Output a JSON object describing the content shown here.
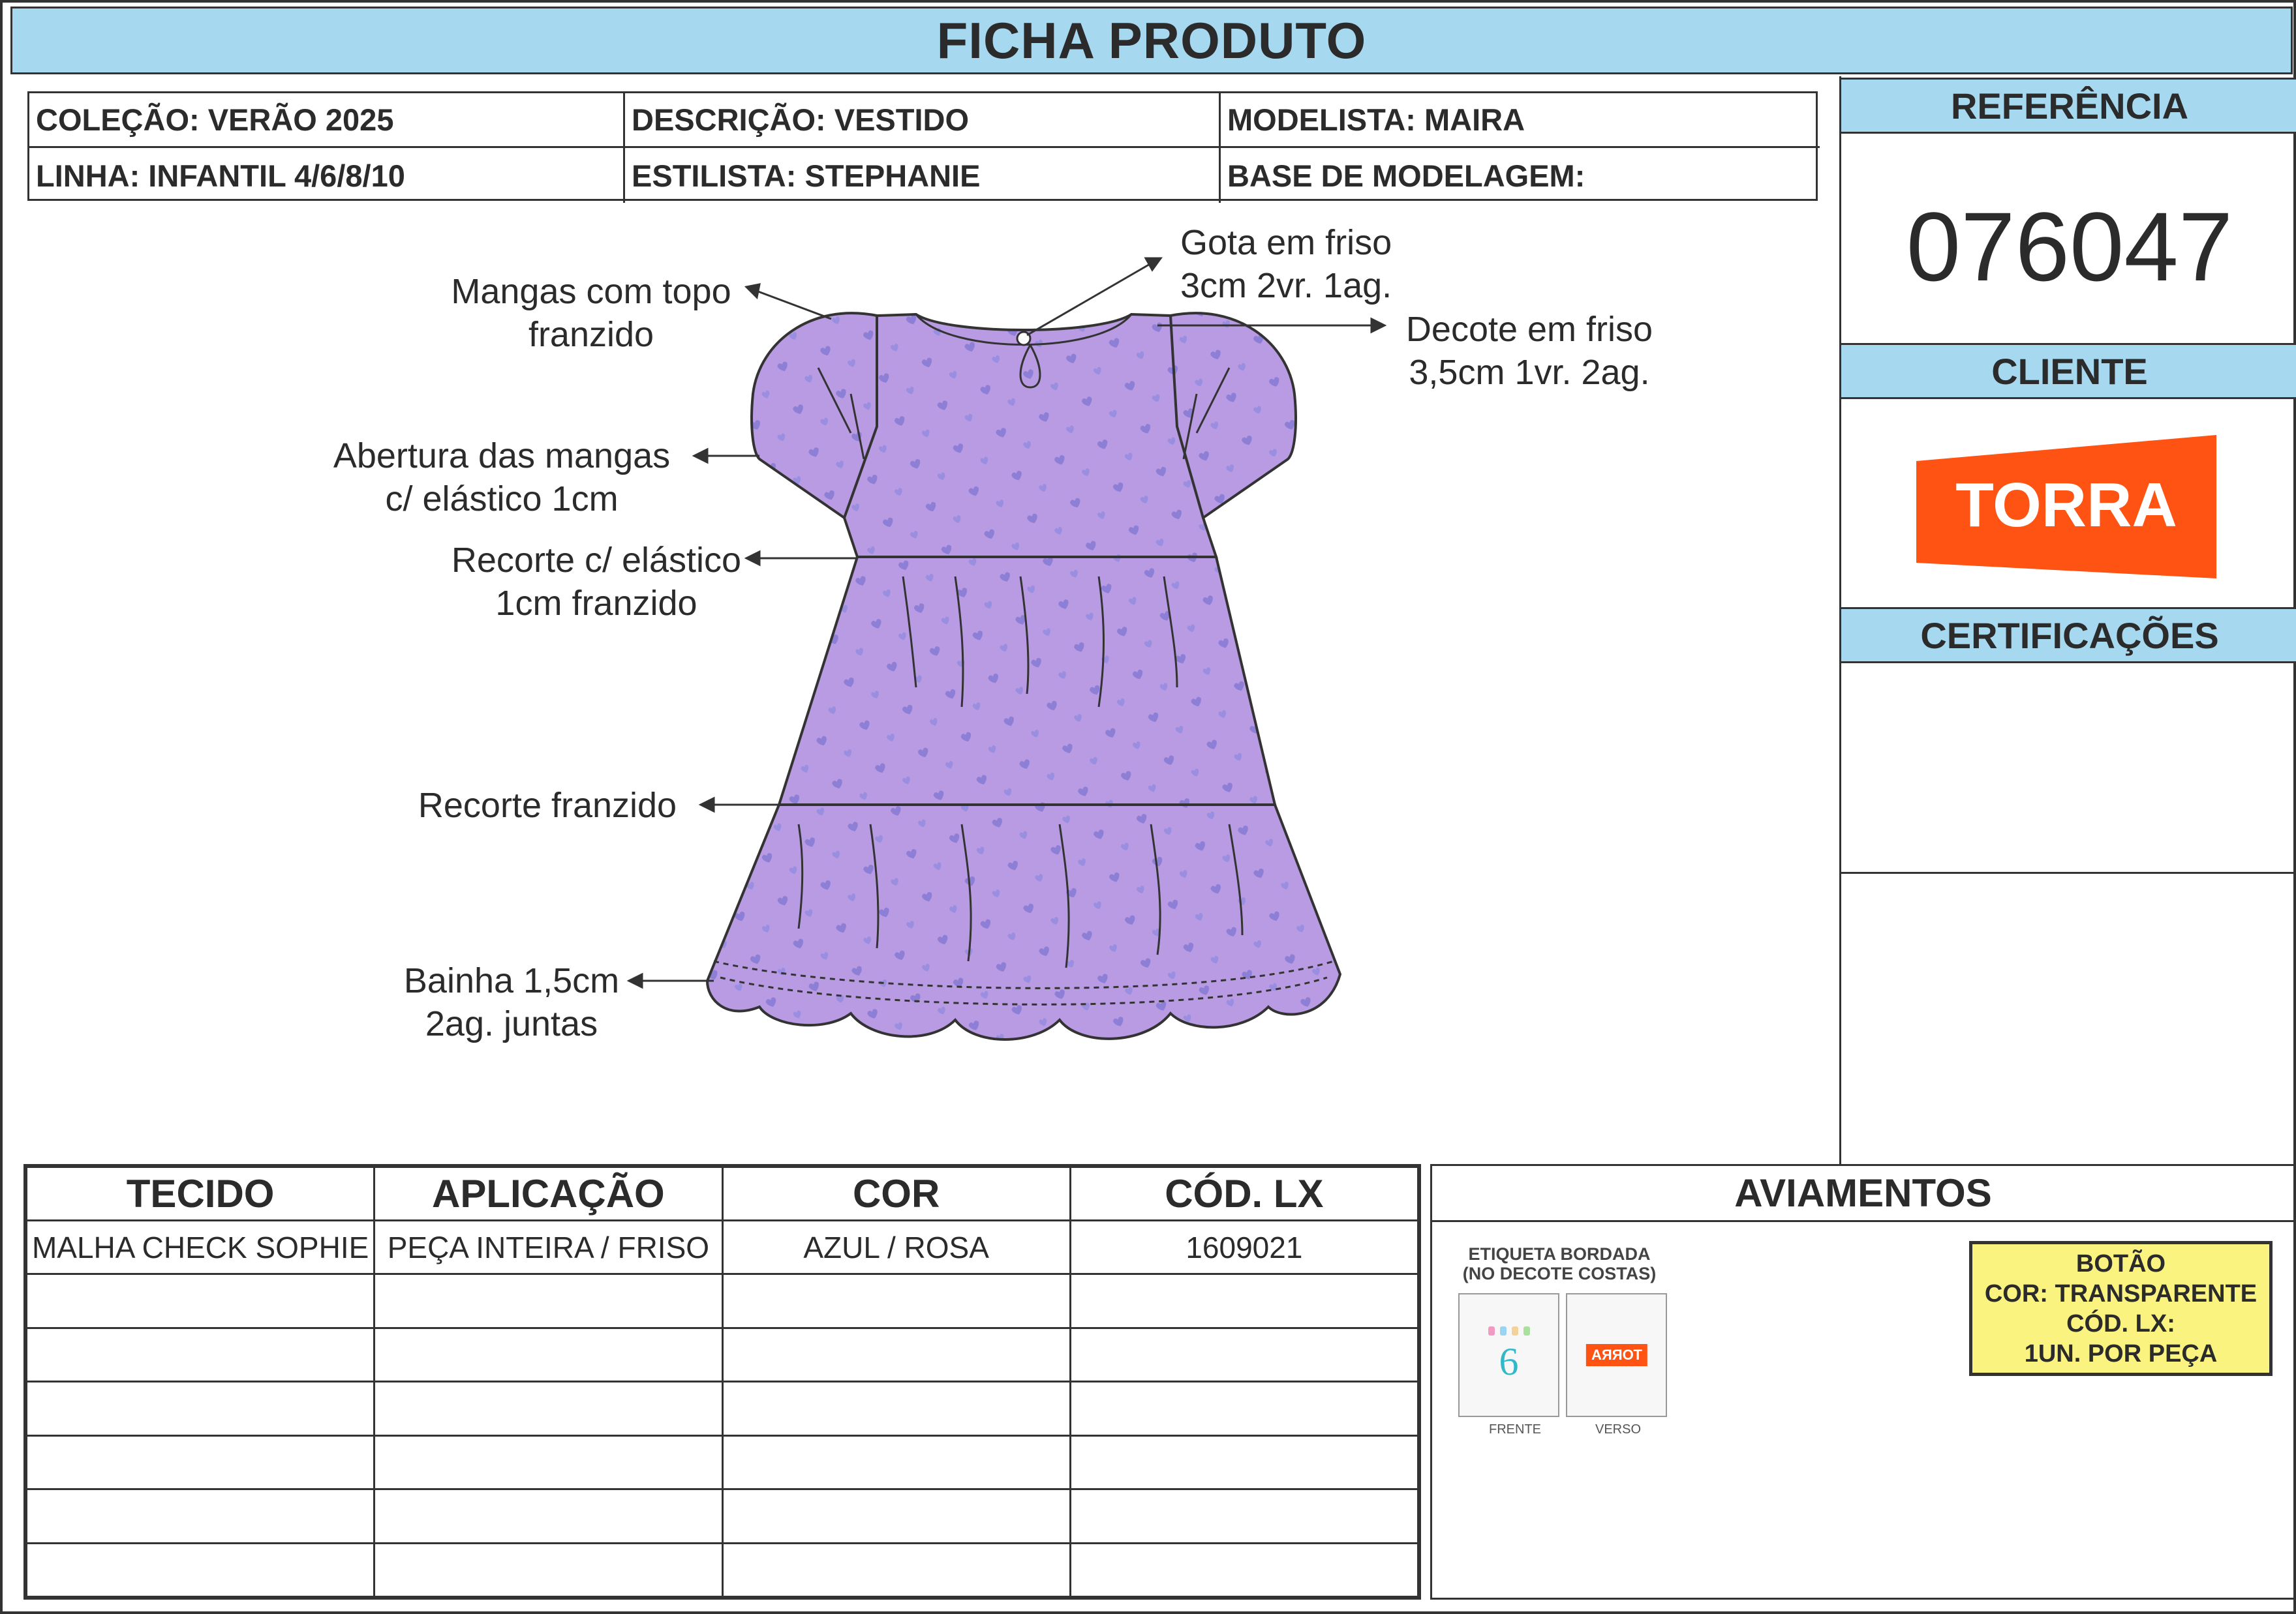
{
  "header": {
    "title": "FICHA PRODUTO"
  },
  "info": {
    "colecao": "COLEÇÃO: VERÃO 2025",
    "descricao": "DESCRIÇÃO: VESTIDO",
    "modelista": "MODELISTA: MAIRA",
    "linha": "LINHA: INFANTIL 4/6/8/10",
    "estilista": "ESTILISTA: STEPHANIE",
    "base": "BASE DE MODELAGEM:"
  },
  "panel": {
    "referencia_label": "REFERÊNCIA",
    "referencia_value": "076047",
    "cliente_label": "CLIENTE",
    "cliente_logo": "TORRA",
    "certificacoes_label": "CERTIFICAÇÕES",
    "brand_color": "#ff5313"
  },
  "callouts": {
    "mangas_1": "Mangas com topo",
    "mangas_2": "franzido",
    "gota_1": "Gota em friso",
    "gota_2": "3cm 2vr. 1ag.",
    "decote_1": "Decote em friso",
    "decote_2": "3,5cm 1vr. 2ag.",
    "abertura_1": "Abertura das mangas",
    "abertura_2": "c/ elástico 1cm",
    "recorte_el_1": "Recorte c/ elástico",
    "recorte_el_2": "1cm franzido",
    "recorte_fr": "Recorte franzido",
    "bainha_1": "Bainha 1,5cm",
    "bainha_2": "2ag. juntas"
  },
  "garment_color": "#b99be3",
  "materials": {
    "headers": [
      "TECIDO",
      "APLICAÇÃO",
      "COR",
      "CÓD. LX"
    ],
    "rows": [
      [
        "MALHA CHECK SOPHIE",
        "PEÇA INTEIRA / FRISO",
        "AZUL / ROSA",
        "1609021"
      ]
    ]
  },
  "aviamentos": {
    "title": "AVIAMENTOS",
    "label_title_1": "ETIQUETA BORDADA",
    "label_title_2": "(NO DECOTE COSTAS)",
    "label_front_number": "6",
    "label_back_logo": "TORRA",
    "frente": "FRENTE",
    "verso": "VERSO",
    "botao": {
      "line1": "BOTÃO",
      "line2": "COR: TRANSPARENTE",
      "line3": "CÓD. LX:",
      "line4": "1UN. POR PEÇA"
    }
  }
}
